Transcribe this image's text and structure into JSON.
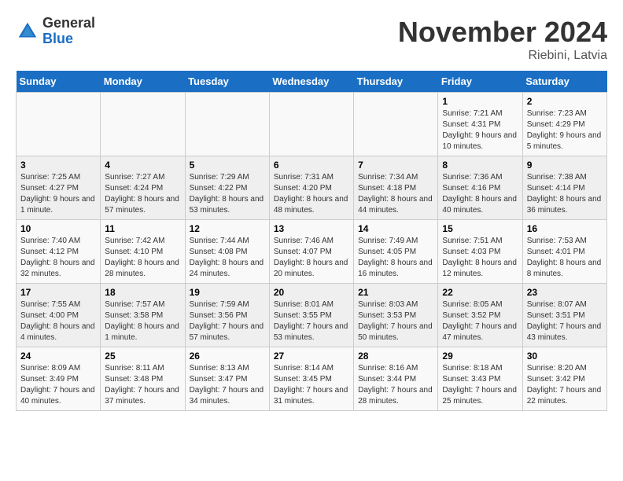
{
  "logo": {
    "general": "General",
    "blue": "Blue"
  },
  "header": {
    "month": "November 2024",
    "location": "Riebini, Latvia"
  },
  "weekdays": [
    "Sunday",
    "Monday",
    "Tuesday",
    "Wednesday",
    "Thursday",
    "Friday",
    "Saturday"
  ],
  "weeks": [
    [
      {
        "day": "",
        "sunrise": "",
        "sunset": "",
        "daylight": ""
      },
      {
        "day": "",
        "sunrise": "",
        "sunset": "",
        "daylight": ""
      },
      {
        "day": "",
        "sunrise": "",
        "sunset": "",
        "daylight": ""
      },
      {
        "day": "",
        "sunrise": "",
        "sunset": "",
        "daylight": ""
      },
      {
        "day": "",
        "sunrise": "",
        "sunset": "",
        "daylight": ""
      },
      {
        "day": "1",
        "sunrise": "Sunrise: 7:21 AM",
        "sunset": "Sunset: 4:31 PM",
        "daylight": "Daylight: 9 hours and 10 minutes."
      },
      {
        "day": "2",
        "sunrise": "Sunrise: 7:23 AM",
        "sunset": "Sunset: 4:29 PM",
        "daylight": "Daylight: 9 hours and 5 minutes."
      }
    ],
    [
      {
        "day": "3",
        "sunrise": "Sunrise: 7:25 AM",
        "sunset": "Sunset: 4:27 PM",
        "daylight": "Daylight: 9 hours and 1 minute."
      },
      {
        "day": "4",
        "sunrise": "Sunrise: 7:27 AM",
        "sunset": "Sunset: 4:24 PM",
        "daylight": "Daylight: 8 hours and 57 minutes."
      },
      {
        "day": "5",
        "sunrise": "Sunrise: 7:29 AM",
        "sunset": "Sunset: 4:22 PM",
        "daylight": "Daylight: 8 hours and 53 minutes."
      },
      {
        "day": "6",
        "sunrise": "Sunrise: 7:31 AM",
        "sunset": "Sunset: 4:20 PM",
        "daylight": "Daylight: 8 hours and 48 minutes."
      },
      {
        "day": "7",
        "sunrise": "Sunrise: 7:34 AM",
        "sunset": "Sunset: 4:18 PM",
        "daylight": "Daylight: 8 hours and 44 minutes."
      },
      {
        "day": "8",
        "sunrise": "Sunrise: 7:36 AM",
        "sunset": "Sunset: 4:16 PM",
        "daylight": "Daylight: 8 hours and 40 minutes."
      },
      {
        "day": "9",
        "sunrise": "Sunrise: 7:38 AM",
        "sunset": "Sunset: 4:14 PM",
        "daylight": "Daylight: 8 hours and 36 minutes."
      }
    ],
    [
      {
        "day": "10",
        "sunrise": "Sunrise: 7:40 AM",
        "sunset": "Sunset: 4:12 PM",
        "daylight": "Daylight: 8 hours and 32 minutes."
      },
      {
        "day": "11",
        "sunrise": "Sunrise: 7:42 AM",
        "sunset": "Sunset: 4:10 PM",
        "daylight": "Daylight: 8 hours and 28 minutes."
      },
      {
        "day": "12",
        "sunrise": "Sunrise: 7:44 AM",
        "sunset": "Sunset: 4:08 PM",
        "daylight": "Daylight: 8 hours and 24 minutes."
      },
      {
        "day": "13",
        "sunrise": "Sunrise: 7:46 AM",
        "sunset": "Sunset: 4:07 PM",
        "daylight": "Daylight: 8 hours and 20 minutes."
      },
      {
        "day": "14",
        "sunrise": "Sunrise: 7:49 AM",
        "sunset": "Sunset: 4:05 PM",
        "daylight": "Daylight: 8 hours and 16 minutes."
      },
      {
        "day": "15",
        "sunrise": "Sunrise: 7:51 AM",
        "sunset": "Sunset: 4:03 PM",
        "daylight": "Daylight: 8 hours and 12 minutes."
      },
      {
        "day": "16",
        "sunrise": "Sunrise: 7:53 AM",
        "sunset": "Sunset: 4:01 PM",
        "daylight": "Daylight: 8 hours and 8 minutes."
      }
    ],
    [
      {
        "day": "17",
        "sunrise": "Sunrise: 7:55 AM",
        "sunset": "Sunset: 4:00 PM",
        "daylight": "Daylight: 8 hours and 4 minutes."
      },
      {
        "day": "18",
        "sunrise": "Sunrise: 7:57 AM",
        "sunset": "Sunset: 3:58 PM",
        "daylight": "Daylight: 8 hours and 1 minute."
      },
      {
        "day": "19",
        "sunrise": "Sunrise: 7:59 AM",
        "sunset": "Sunset: 3:56 PM",
        "daylight": "Daylight: 7 hours and 57 minutes."
      },
      {
        "day": "20",
        "sunrise": "Sunrise: 8:01 AM",
        "sunset": "Sunset: 3:55 PM",
        "daylight": "Daylight: 7 hours and 53 minutes."
      },
      {
        "day": "21",
        "sunrise": "Sunrise: 8:03 AM",
        "sunset": "Sunset: 3:53 PM",
        "daylight": "Daylight: 7 hours and 50 minutes."
      },
      {
        "day": "22",
        "sunrise": "Sunrise: 8:05 AM",
        "sunset": "Sunset: 3:52 PM",
        "daylight": "Daylight: 7 hours and 47 minutes."
      },
      {
        "day": "23",
        "sunrise": "Sunrise: 8:07 AM",
        "sunset": "Sunset: 3:51 PM",
        "daylight": "Daylight: 7 hours and 43 minutes."
      }
    ],
    [
      {
        "day": "24",
        "sunrise": "Sunrise: 8:09 AM",
        "sunset": "Sunset: 3:49 PM",
        "daylight": "Daylight: 7 hours and 40 minutes."
      },
      {
        "day": "25",
        "sunrise": "Sunrise: 8:11 AM",
        "sunset": "Sunset: 3:48 PM",
        "daylight": "Daylight: 7 hours and 37 minutes."
      },
      {
        "day": "26",
        "sunrise": "Sunrise: 8:13 AM",
        "sunset": "Sunset: 3:47 PM",
        "daylight": "Daylight: 7 hours and 34 minutes."
      },
      {
        "day": "27",
        "sunrise": "Sunrise: 8:14 AM",
        "sunset": "Sunset: 3:45 PM",
        "daylight": "Daylight: 7 hours and 31 minutes."
      },
      {
        "day": "28",
        "sunrise": "Sunrise: 8:16 AM",
        "sunset": "Sunset: 3:44 PM",
        "daylight": "Daylight: 7 hours and 28 minutes."
      },
      {
        "day": "29",
        "sunrise": "Sunrise: 8:18 AM",
        "sunset": "Sunset: 3:43 PM",
        "daylight": "Daylight: 7 hours and 25 minutes."
      },
      {
        "day": "30",
        "sunrise": "Sunrise: 8:20 AM",
        "sunset": "Sunset: 3:42 PM",
        "daylight": "Daylight: 7 hours and 22 minutes."
      }
    ]
  ]
}
